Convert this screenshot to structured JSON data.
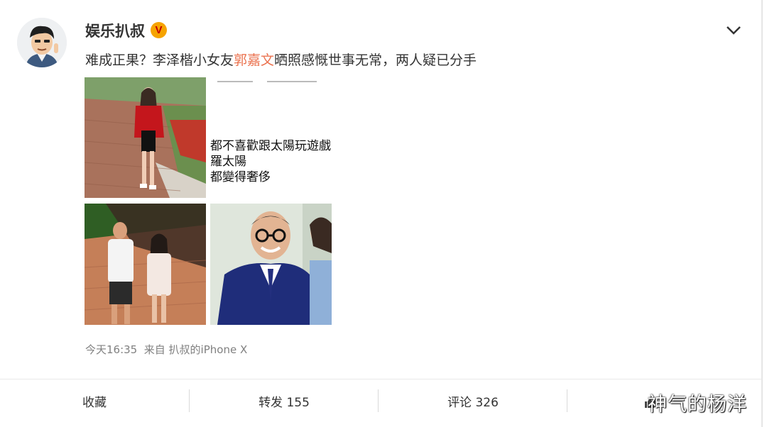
{
  "author": {
    "name": "娱乐扒叔",
    "verified_badge": "V"
  },
  "post": {
    "text_before": "难成正果？李泽楷小女友",
    "highlight": "郭嘉文",
    "text_after": "晒照感慨世事无常，两人疑已分手",
    "highlight_color": "#eb7350"
  },
  "images": {
    "quote_lines": "都不喜歡跟太陽玩遊戲\n羅太陽\n都變得奢侈\n"
  },
  "meta": {
    "time": "今天16:35",
    "source": "来自 扒叔的iPhone X"
  },
  "actions": {
    "favorite": "收藏",
    "repost": "转发 155",
    "comment": "评论 326",
    "like": ""
  },
  "watermark": "神气的杨洋"
}
